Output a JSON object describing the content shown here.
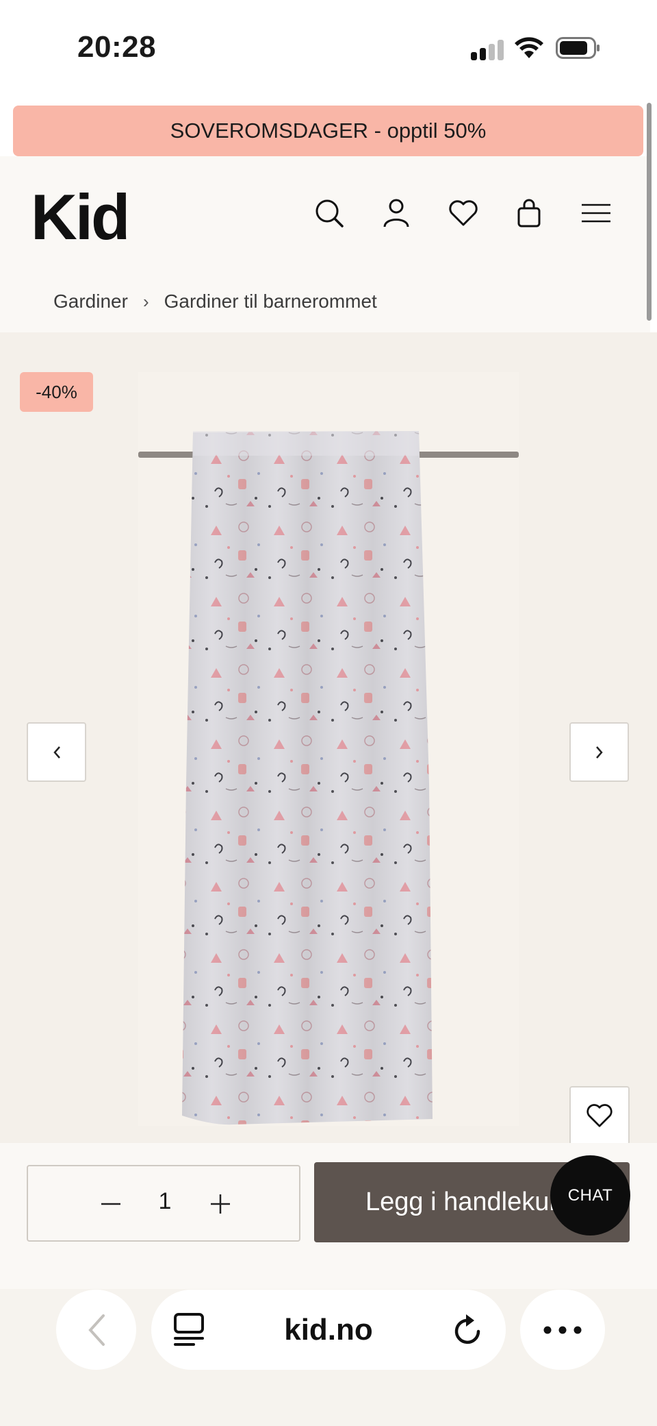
{
  "status_bar": {
    "time": "20:28"
  },
  "promo": {
    "text": "SOVEROMSDAGER - opptil 50%"
  },
  "header": {
    "logo": "Kid",
    "icons": [
      "search-icon",
      "account-icon",
      "wishlist-icon",
      "cart-icon",
      "menu-icon"
    ]
  },
  "breadcrumb": {
    "items": [
      "Gardiner",
      "Gardiner til barnerommet"
    ]
  },
  "product": {
    "discount_badge": "-40%"
  },
  "buy": {
    "quantity": "1",
    "add_label": "Legg i handlekurv",
    "chat_label": "CHAT"
  },
  "browser": {
    "url": "kid.no"
  },
  "colors": {
    "promo": "#f9b6a7",
    "cta": "#5d544f",
    "page_bg": "#f4f0ea",
    "curtain_motif": "#e49aa0"
  }
}
